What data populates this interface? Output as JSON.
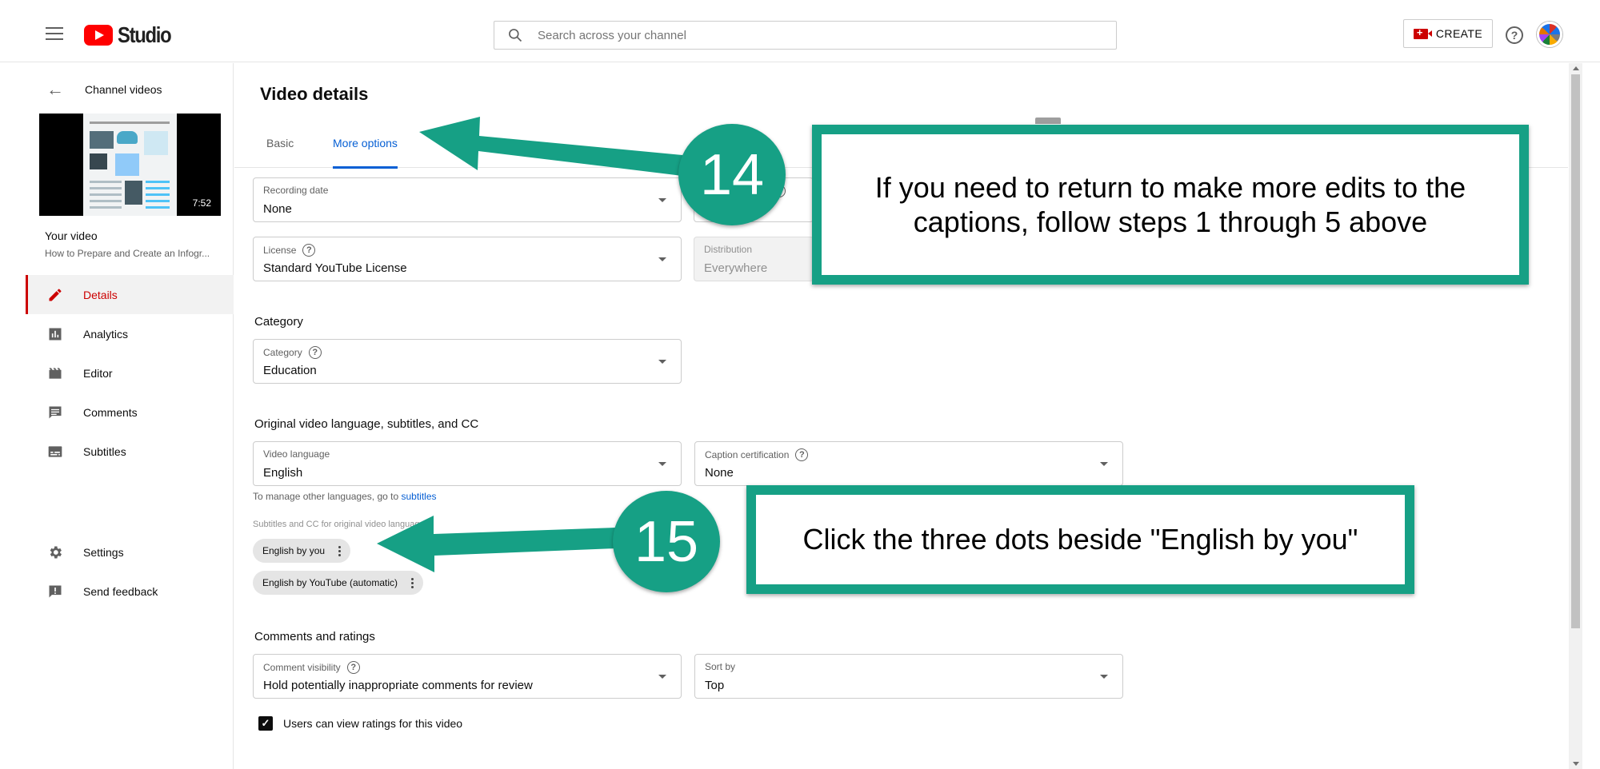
{
  "topbar": {
    "logo_text": "Studio",
    "search_placeholder": "Search across your channel",
    "create_label": "CREATE"
  },
  "sidebar": {
    "back_label": "Channel videos",
    "video": {
      "duration": "7:52",
      "heading": "Your video",
      "title": "How to Prepare and Create an Infogr..."
    },
    "nav": [
      {
        "label": "Details",
        "icon": "pencil-icon",
        "active": true
      },
      {
        "label": "Analytics",
        "icon": "analytics-icon"
      },
      {
        "label": "Editor",
        "icon": "editor-icon"
      },
      {
        "label": "Comments",
        "icon": "comments-icon"
      },
      {
        "label": "Subtitles",
        "icon": "subtitles-icon"
      }
    ],
    "bottom_nav": [
      {
        "label": "Settings",
        "icon": "gear-icon"
      },
      {
        "label": "Send feedback",
        "icon": "feedback-icon"
      }
    ]
  },
  "main": {
    "title": "Video details",
    "tabs": [
      {
        "label": "Basic"
      },
      {
        "label": "More options",
        "active": true
      }
    ],
    "fields": {
      "recording_date": {
        "label": "Recording date",
        "value": "None"
      },
      "license": {
        "label": "License",
        "value": "Standard YouTube License"
      },
      "distribution": {
        "label": "Distribution",
        "value": "Everywhere"
      },
      "category": {
        "label": "Category",
        "value": "Education"
      },
      "video_language": {
        "label": "Video language",
        "value": "English"
      },
      "caption_certification": {
        "label": "Caption certification",
        "value": "None"
      },
      "comment_visibility": {
        "label": "Comment visibility",
        "value": "Hold potentially inappropriate comments for review"
      },
      "sort_by": {
        "label": "Sort by",
        "value": "Top"
      }
    },
    "sections": {
      "category": "Category",
      "language": "Original video language, subtitles, and CC",
      "comments": "Comments and ratings"
    },
    "helper_prefix": "To manage other languages, go to",
    "helper_link": "subtitles",
    "subtitles_label": "Subtitles and CC for original video language",
    "subtitle_chips": [
      "English by you",
      "English by YouTube (automatic)"
    ],
    "ratings_checkbox": "Users can view ratings for this video"
  },
  "annotations": {
    "step1": "14",
    "step1_text": "If you need to return to make more edits to the captions, follow steps 1 through 5 above",
    "step2": "15",
    "step2_text": "Click the three dots beside \"English by you\"",
    "accent_color": "#16a085"
  }
}
